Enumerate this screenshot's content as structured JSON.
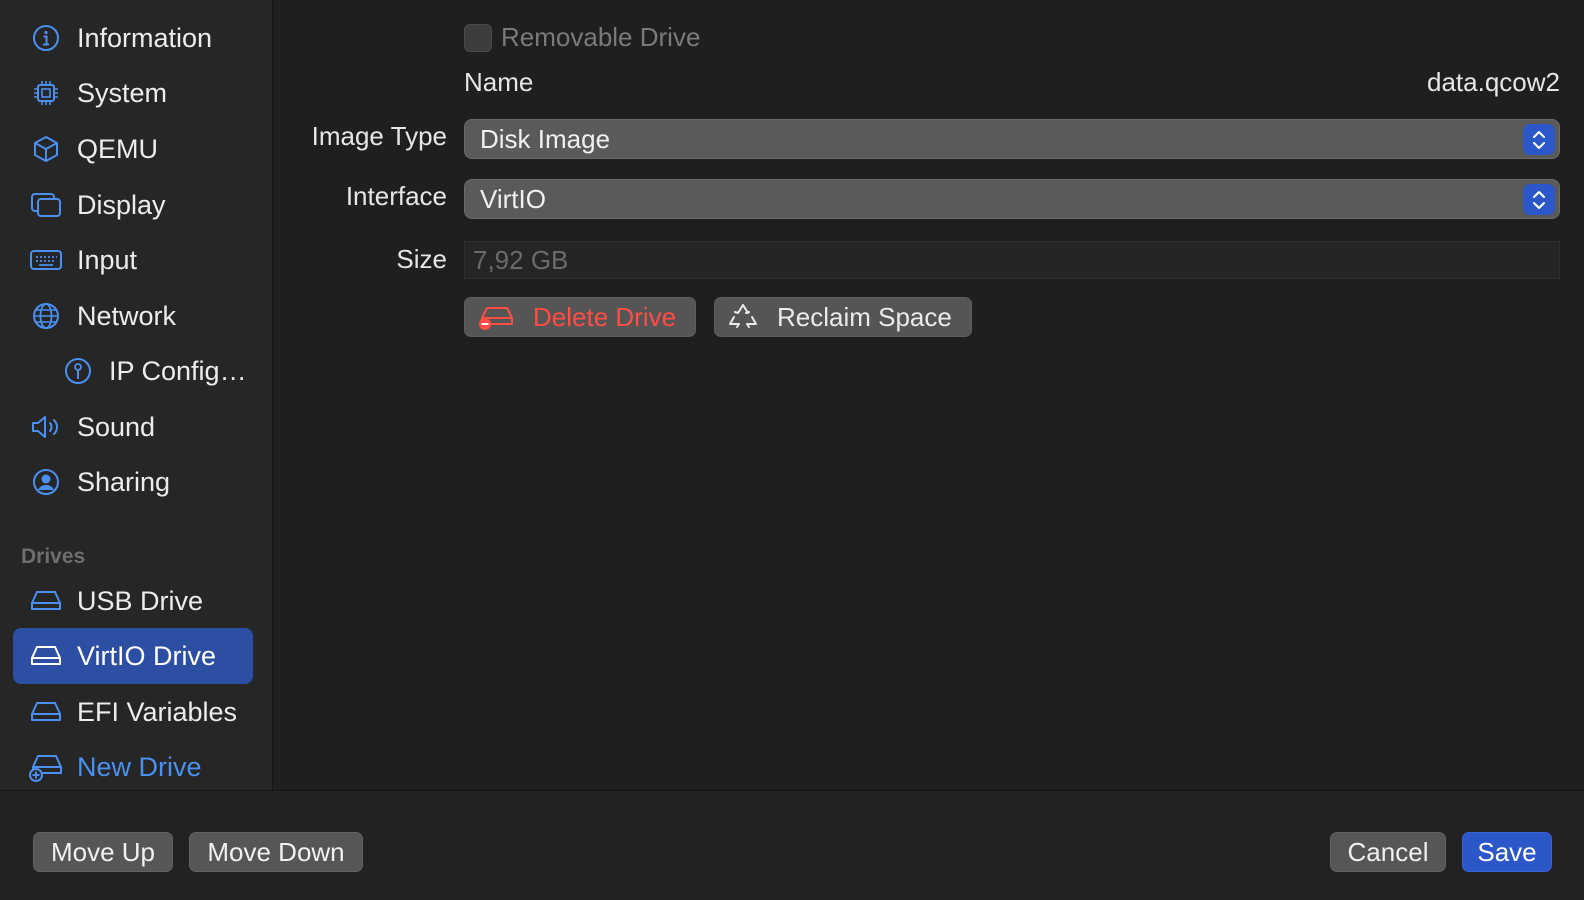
{
  "sidebar": {
    "items": [
      {
        "label": "Information",
        "icon": "info-circle-icon"
      },
      {
        "label": "System",
        "icon": "cpu-chip-icon"
      },
      {
        "label": "QEMU",
        "icon": "cube-icon"
      },
      {
        "label": "Display",
        "icon": "display-windows-icon"
      },
      {
        "label": "Input",
        "icon": "keyboard-icon"
      },
      {
        "label": "Network",
        "icon": "globe-icon"
      },
      {
        "label": "IP Config…",
        "icon": "ip-config-icon"
      },
      {
        "label": "Sound",
        "icon": "speaker-icon"
      },
      {
        "label": "Sharing",
        "icon": "person-circle-icon"
      }
    ],
    "drives_header": "Drives",
    "drives": [
      {
        "label": "USB Drive",
        "icon": "drive-icon"
      },
      {
        "label": "VirtIO Drive",
        "icon": "drive-icon",
        "selected": true
      },
      {
        "label": "EFI Variables",
        "icon": "drive-icon"
      },
      {
        "label": "New Drive",
        "icon": "drive-add-icon"
      }
    ]
  },
  "form": {
    "removable_label": "Removable Drive",
    "removable_checked": false,
    "name_label": "Name",
    "name_value": "data.qcow2",
    "image_type_label": "Image Type",
    "image_type_value": "Disk Image",
    "interface_label": "Interface",
    "interface_value": "VirtIO",
    "size_label": "Size",
    "size_value": "7,92 GB",
    "delete_label": "Delete Drive",
    "reclaim_label": "Reclaim Space"
  },
  "bottom": {
    "move_up": "Move Up",
    "move_down": "Move Down",
    "cancel": "Cancel",
    "save": "Save"
  },
  "colors": {
    "accent": "#2c57c9",
    "selection": "#2c4fa3",
    "icon_blue": "#4a90f0",
    "danger": "#ff4d45"
  }
}
